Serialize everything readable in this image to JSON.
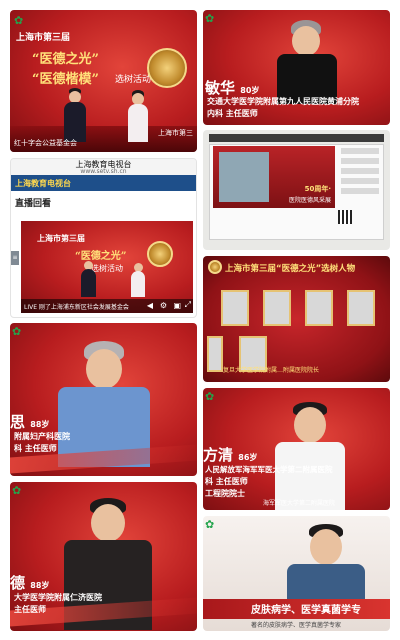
{
  "tile1": {
    "event_line": "上海市第三届",
    "phrase_a": "“医德之光”",
    "phrase_b": "“医德楷模”",
    "activity": "选树活动",
    "foot_left": "红十字会公益基金会",
    "foot_right": "上海市第三"
  },
  "tile2": {
    "name": "敏华",
    "age": "80岁",
    "hosp_line1": "交通大学医学院附属第九人民医院黄浦分院",
    "hosp_line2": "内科 主任医师"
  },
  "tile3": {
    "video_caption": "50周年·",
    "video_caption2": "医院医德风采展"
  },
  "tile4": {
    "browser_title": "上海教育电视台",
    "browser_url": "www.setv.sh.cn",
    "brand": "上海教育电视台",
    "section_title": "直播回看",
    "player_line1": "上海市第三届",
    "player_line2": "“医德之光”",
    "player_line3": "选树活动",
    "live_text": "LIVE 刚了上海浦东新区社会发展基金会",
    "side_button": "≡"
  },
  "tile5": {
    "header": "上海市第三届“医德之光”选树人物",
    "bottom_caption": "复旦大学医学院附属…附属医院院长"
  },
  "tile6": {
    "name": "思",
    "age": "88岁",
    "hosp_line1": "附属妇产科医院",
    "hosp_line2": "科 主任医师"
  },
  "tile7": {
    "name": "方清",
    "age": "86岁",
    "hosp_line1": "人民解放军海军军医大学第二附属医院",
    "hosp_line2": "科 主任医师",
    "hosp_line3": "工程院院士",
    "footer": "海军军医大学第二附属医院"
  },
  "tile8": {
    "name": "德",
    "age": "88岁",
    "hosp_line1": "大学医学院附属仁济医院",
    "hosp_line2": "主任医师"
  },
  "tile9": {
    "band_text": "皮肤病学、医学真菌学专",
    "sub_text": "著名的皮肤病学、医学真菌学专家"
  },
  "colors": {
    "primary_red": "#b81d1f",
    "gold": "#ffe17a",
    "channel_blue": "#1e4f8a",
    "logo_green": "#23a44c"
  }
}
